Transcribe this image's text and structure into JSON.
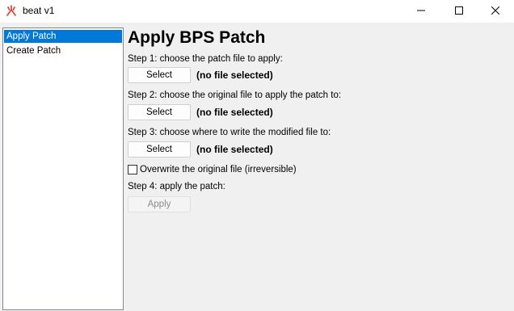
{
  "window": {
    "title": "beat v1",
    "app_icon": "fire-kanji-icon",
    "controls": [
      "minimize-icon",
      "maximize-icon",
      "close-icon"
    ]
  },
  "sidebar": {
    "items": [
      {
        "label": "Apply Patch",
        "selected": true
      },
      {
        "label": "Create Patch",
        "selected": false
      }
    ]
  },
  "main": {
    "heading": "Apply BPS Patch",
    "step1": {
      "label": "Step 1: choose the patch file to apply:",
      "button": "Select",
      "file": "(no file selected)"
    },
    "step2": {
      "label": "Step 2: choose the original file to apply the patch to:",
      "button": "Select",
      "file": "(no file selected)"
    },
    "step3": {
      "label": "Step 3: choose where to write the modified file to:",
      "button": "Select",
      "file": "(no file selected)"
    },
    "overwrite": {
      "label": "Overwrite the original file (irreversible)",
      "checked": false
    },
    "step4": {
      "label": "Step 4: apply the patch:",
      "button": "Apply",
      "enabled": false
    }
  },
  "colors": {
    "selection": "#0078d7",
    "window_bg": "#f0f0f0",
    "app_icon": "#e03a2a"
  }
}
